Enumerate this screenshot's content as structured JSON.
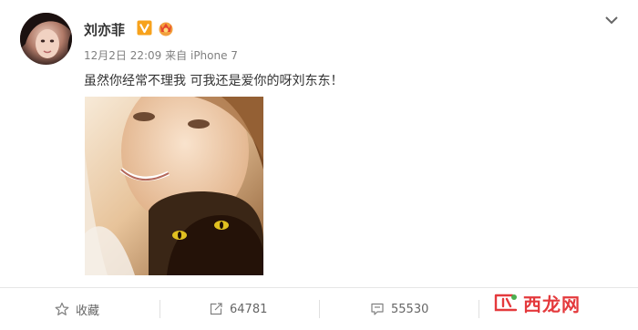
{
  "post": {
    "username": "刘亦菲",
    "timestamp": "12月2日 22:09",
    "source_prefix": "来自",
    "source_device": "iPhone 7",
    "text": "虽然你经常不理我 可我还是爱你的呀刘东东！"
  },
  "actions": {
    "favorite_label": "收藏",
    "repost_count": "64781",
    "comment_count": "55530"
  },
  "watermark": {
    "text": "西龙网"
  },
  "icons": {
    "verified": "verified-v-badge-icon",
    "level": "member-crown-icon",
    "more": "chevron-down-icon",
    "favorite": "star-icon",
    "repost": "repost-icon",
    "comment": "comment-icon"
  },
  "colors": {
    "username": "#333333",
    "meta": "#808080",
    "verified_badge": "#f7a21c",
    "watermark": "#e4393c"
  }
}
